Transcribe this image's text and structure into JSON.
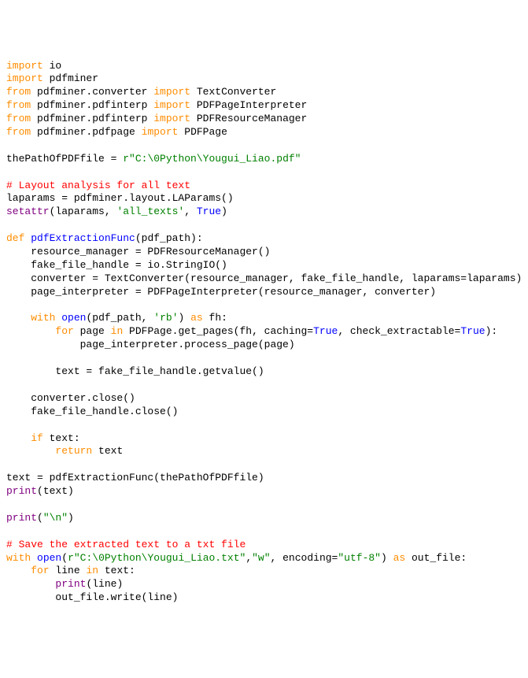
{
  "lines": [
    {
      "segs": [
        {
          "t": "import",
          "c": "kw"
        },
        {
          "t": " io",
          "c": "ident"
        }
      ]
    },
    {
      "segs": [
        {
          "t": "import",
          "c": "kw"
        },
        {
          "t": " pdfminer",
          "c": "ident"
        }
      ]
    },
    {
      "segs": [
        {
          "t": "from",
          "c": "kw"
        },
        {
          "t": " pdfminer.converter ",
          "c": "ident"
        },
        {
          "t": "import",
          "c": "kw"
        },
        {
          "t": " TextConverter",
          "c": "ident"
        }
      ]
    },
    {
      "segs": [
        {
          "t": "from",
          "c": "kw"
        },
        {
          "t": " pdfminer.pdfinterp ",
          "c": "ident"
        },
        {
          "t": "import",
          "c": "kw"
        },
        {
          "t": " PDFPageInterpreter",
          "c": "ident"
        }
      ]
    },
    {
      "segs": [
        {
          "t": "from",
          "c": "kw"
        },
        {
          "t": " pdfminer.pdfinterp ",
          "c": "ident"
        },
        {
          "t": "import",
          "c": "kw"
        },
        {
          "t": " PDFResourceManager",
          "c": "ident"
        }
      ]
    },
    {
      "segs": [
        {
          "t": "from",
          "c": "kw"
        },
        {
          "t": " pdfminer.pdfpage ",
          "c": "ident"
        },
        {
          "t": "import",
          "c": "kw"
        },
        {
          "t": " PDFPage",
          "c": "ident"
        }
      ]
    },
    {
      "segs": [
        {
          "t": " ",
          "c": "ident"
        }
      ]
    },
    {
      "segs": [
        {
          "t": "thePathOfPDFfile = ",
          "c": "ident"
        },
        {
          "t": "r\"C:\\0Python\\Yougui_Liao.pdf\"",
          "c": "str"
        }
      ]
    },
    {
      "segs": [
        {
          "t": " ",
          "c": "ident"
        }
      ]
    },
    {
      "segs": [
        {
          "t": "# Layout analysis for all text",
          "c": "comment"
        }
      ]
    },
    {
      "segs": [
        {
          "t": "laparams = pdfminer.layout.LAParams()",
          "c": "ident"
        }
      ]
    },
    {
      "segs": [
        {
          "t": "setattr",
          "c": "builtin"
        },
        {
          "t": "(laparams, ",
          "c": "ident"
        },
        {
          "t": "'all_texts'",
          "c": "str"
        },
        {
          "t": ", ",
          "c": "ident"
        },
        {
          "t": "True",
          "c": "kw-blue"
        },
        {
          "t": ")",
          "c": "ident"
        }
      ]
    },
    {
      "segs": [
        {
          "t": " ",
          "c": "ident"
        }
      ]
    },
    {
      "segs": [
        {
          "t": "def",
          "c": "kw"
        },
        {
          "t": " ",
          "c": "ident"
        },
        {
          "t": "pdfExtractionFunc",
          "c": "funcdef"
        },
        {
          "t": "(pdf_path):",
          "c": "ident"
        }
      ]
    },
    {
      "segs": [
        {
          "t": "    resource_manager = PDFResourceManager()",
          "c": "ident"
        }
      ]
    },
    {
      "segs": [
        {
          "t": "    fake_file_handle = io.StringIO()",
          "c": "ident"
        }
      ]
    },
    {
      "segs": [
        {
          "t": "    converter = TextConverter(resource_manager, fake_file_handle, laparams=laparams)",
          "c": "ident"
        }
      ]
    },
    {
      "segs": [
        {
          "t": "    page_interpreter = PDFPageInterpreter(resource_manager, converter)",
          "c": "ident"
        }
      ]
    },
    {
      "segs": [
        {
          "t": " ",
          "c": "ident"
        }
      ]
    },
    {
      "segs": [
        {
          "t": "    ",
          "c": "ident"
        },
        {
          "t": "with",
          "c": "kw"
        },
        {
          "t": " ",
          "c": "ident"
        },
        {
          "t": "open",
          "c": "kw-blue"
        },
        {
          "t": "(pdf_path, ",
          "c": "ident"
        },
        {
          "t": "'rb'",
          "c": "str"
        },
        {
          "t": ") ",
          "c": "ident"
        },
        {
          "t": "as",
          "c": "kw"
        },
        {
          "t": " fh:",
          "c": "ident"
        }
      ]
    },
    {
      "segs": [
        {
          "t": "        ",
          "c": "ident"
        },
        {
          "t": "for",
          "c": "kw"
        },
        {
          "t": " page ",
          "c": "ident"
        },
        {
          "t": "in",
          "c": "kw"
        },
        {
          "t": " PDFPage.get_pages(fh, caching=",
          "c": "ident"
        },
        {
          "t": "True",
          "c": "kw-blue"
        },
        {
          "t": ", check_extractable=",
          "c": "ident"
        },
        {
          "t": "True",
          "c": "kw-blue"
        },
        {
          "t": "):",
          "c": "ident"
        }
      ]
    },
    {
      "segs": [
        {
          "t": "            page_interpreter.process_page(page)",
          "c": "ident"
        }
      ]
    },
    {
      "segs": [
        {
          "t": " ",
          "c": "ident"
        }
      ]
    },
    {
      "segs": [
        {
          "t": "        text = fake_file_handle.getvalue()",
          "c": "ident"
        }
      ]
    },
    {
      "segs": [
        {
          "t": " ",
          "c": "ident"
        }
      ]
    },
    {
      "segs": [
        {
          "t": "    converter.close()",
          "c": "ident"
        }
      ]
    },
    {
      "segs": [
        {
          "t": "    fake_file_handle.close()",
          "c": "ident"
        }
      ]
    },
    {
      "segs": [
        {
          "t": " ",
          "c": "ident"
        }
      ]
    },
    {
      "segs": [
        {
          "t": "    ",
          "c": "ident"
        },
        {
          "t": "if",
          "c": "kw"
        },
        {
          "t": " text:",
          "c": "ident"
        }
      ]
    },
    {
      "segs": [
        {
          "t": "        ",
          "c": "ident"
        },
        {
          "t": "return",
          "c": "kw"
        },
        {
          "t": " text",
          "c": "ident"
        }
      ]
    },
    {
      "segs": [
        {
          "t": " ",
          "c": "ident"
        }
      ]
    },
    {
      "segs": [
        {
          "t": "text = pdfExtractionFunc(thePathOfPDFfile)",
          "c": "ident"
        }
      ]
    },
    {
      "segs": [
        {
          "t": "print",
          "c": "builtin"
        },
        {
          "t": "(text)",
          "c": "ident"
        }
      ]
    },
    {
      "segs": [
        {
          "t": " ",
          "c": "ident"
        }
      ]
    },
    {
      "segs": [
        {
          "t": "print",
          "c": "builtin"
        },
        {
          "t": "(",
          "c": "ident"
        },
        {
          "t": "\"\\n\"",
          "c": "str"
        },
        {
          "t": ")",
          "c": "ident"
        }
      ]
    },
    {
      "segs": [
        {
          "t": " ",
          "c": "ident"
        }
      ]
    },
    {
      "segs": [
        {
          "t": "# Save the extracted text to a txt file",
          "c": "comment"
        }
      ]
    },
    {
      "segs": [
        {
          "t": "with",
          "c": "kw"
        },
        {
          "t": " ",
          "c": "ident"
        },
        {
          "t": "open",
          "c": "kw-blue"
        },
        {
          "t": "(",
          "c": "ident"
        },
        {
          "t": "r\"C:\\0Python\\Yougui_Liao.txt\"",
          "c": "str"
        },
        {
          "t": ",",
          "c": "ident"
        },
        {
          "t": "\"w\"",
          "c": "str"
        },
        {
          "t": ", encoding=",
          "c": "ident"
        },
        {
          "t": "\"utf-8\"",
          "c": "str"
        },
        {
          "t": ") ",
          "c": "ident"
        },
        {
          "t": "as",
          "c": "kw"
        },
        {
          "t": " out_file:",
          "c": "ident"
        }
      ]
    },
    {
      "segs": [
        {
          "t": "    ",
          "c": "ident"
        },
        {
          "t": "for",
          "c": "kw"
        },
        {
          "t": " line ",
          "c": "ident"
        },
        {
          "t": "in",
          "c": "kw"
        },
        {
          "t": " text:",
          "c": "ident"
        }
      ]
    },
    {
      "segs": [
        {
          "t": "        ",
          "c": "ident"
        },
        {
          "t": "print",
          "c": "builtin"
        },
        {
          "t": "(line)",
          "c": "ident"
        }
      ]
    },
    {
      "segs": [
        {
          "t": "        out_file.write(line)",
          "c": "ident"
        }
      ]
    }
  ]
}
